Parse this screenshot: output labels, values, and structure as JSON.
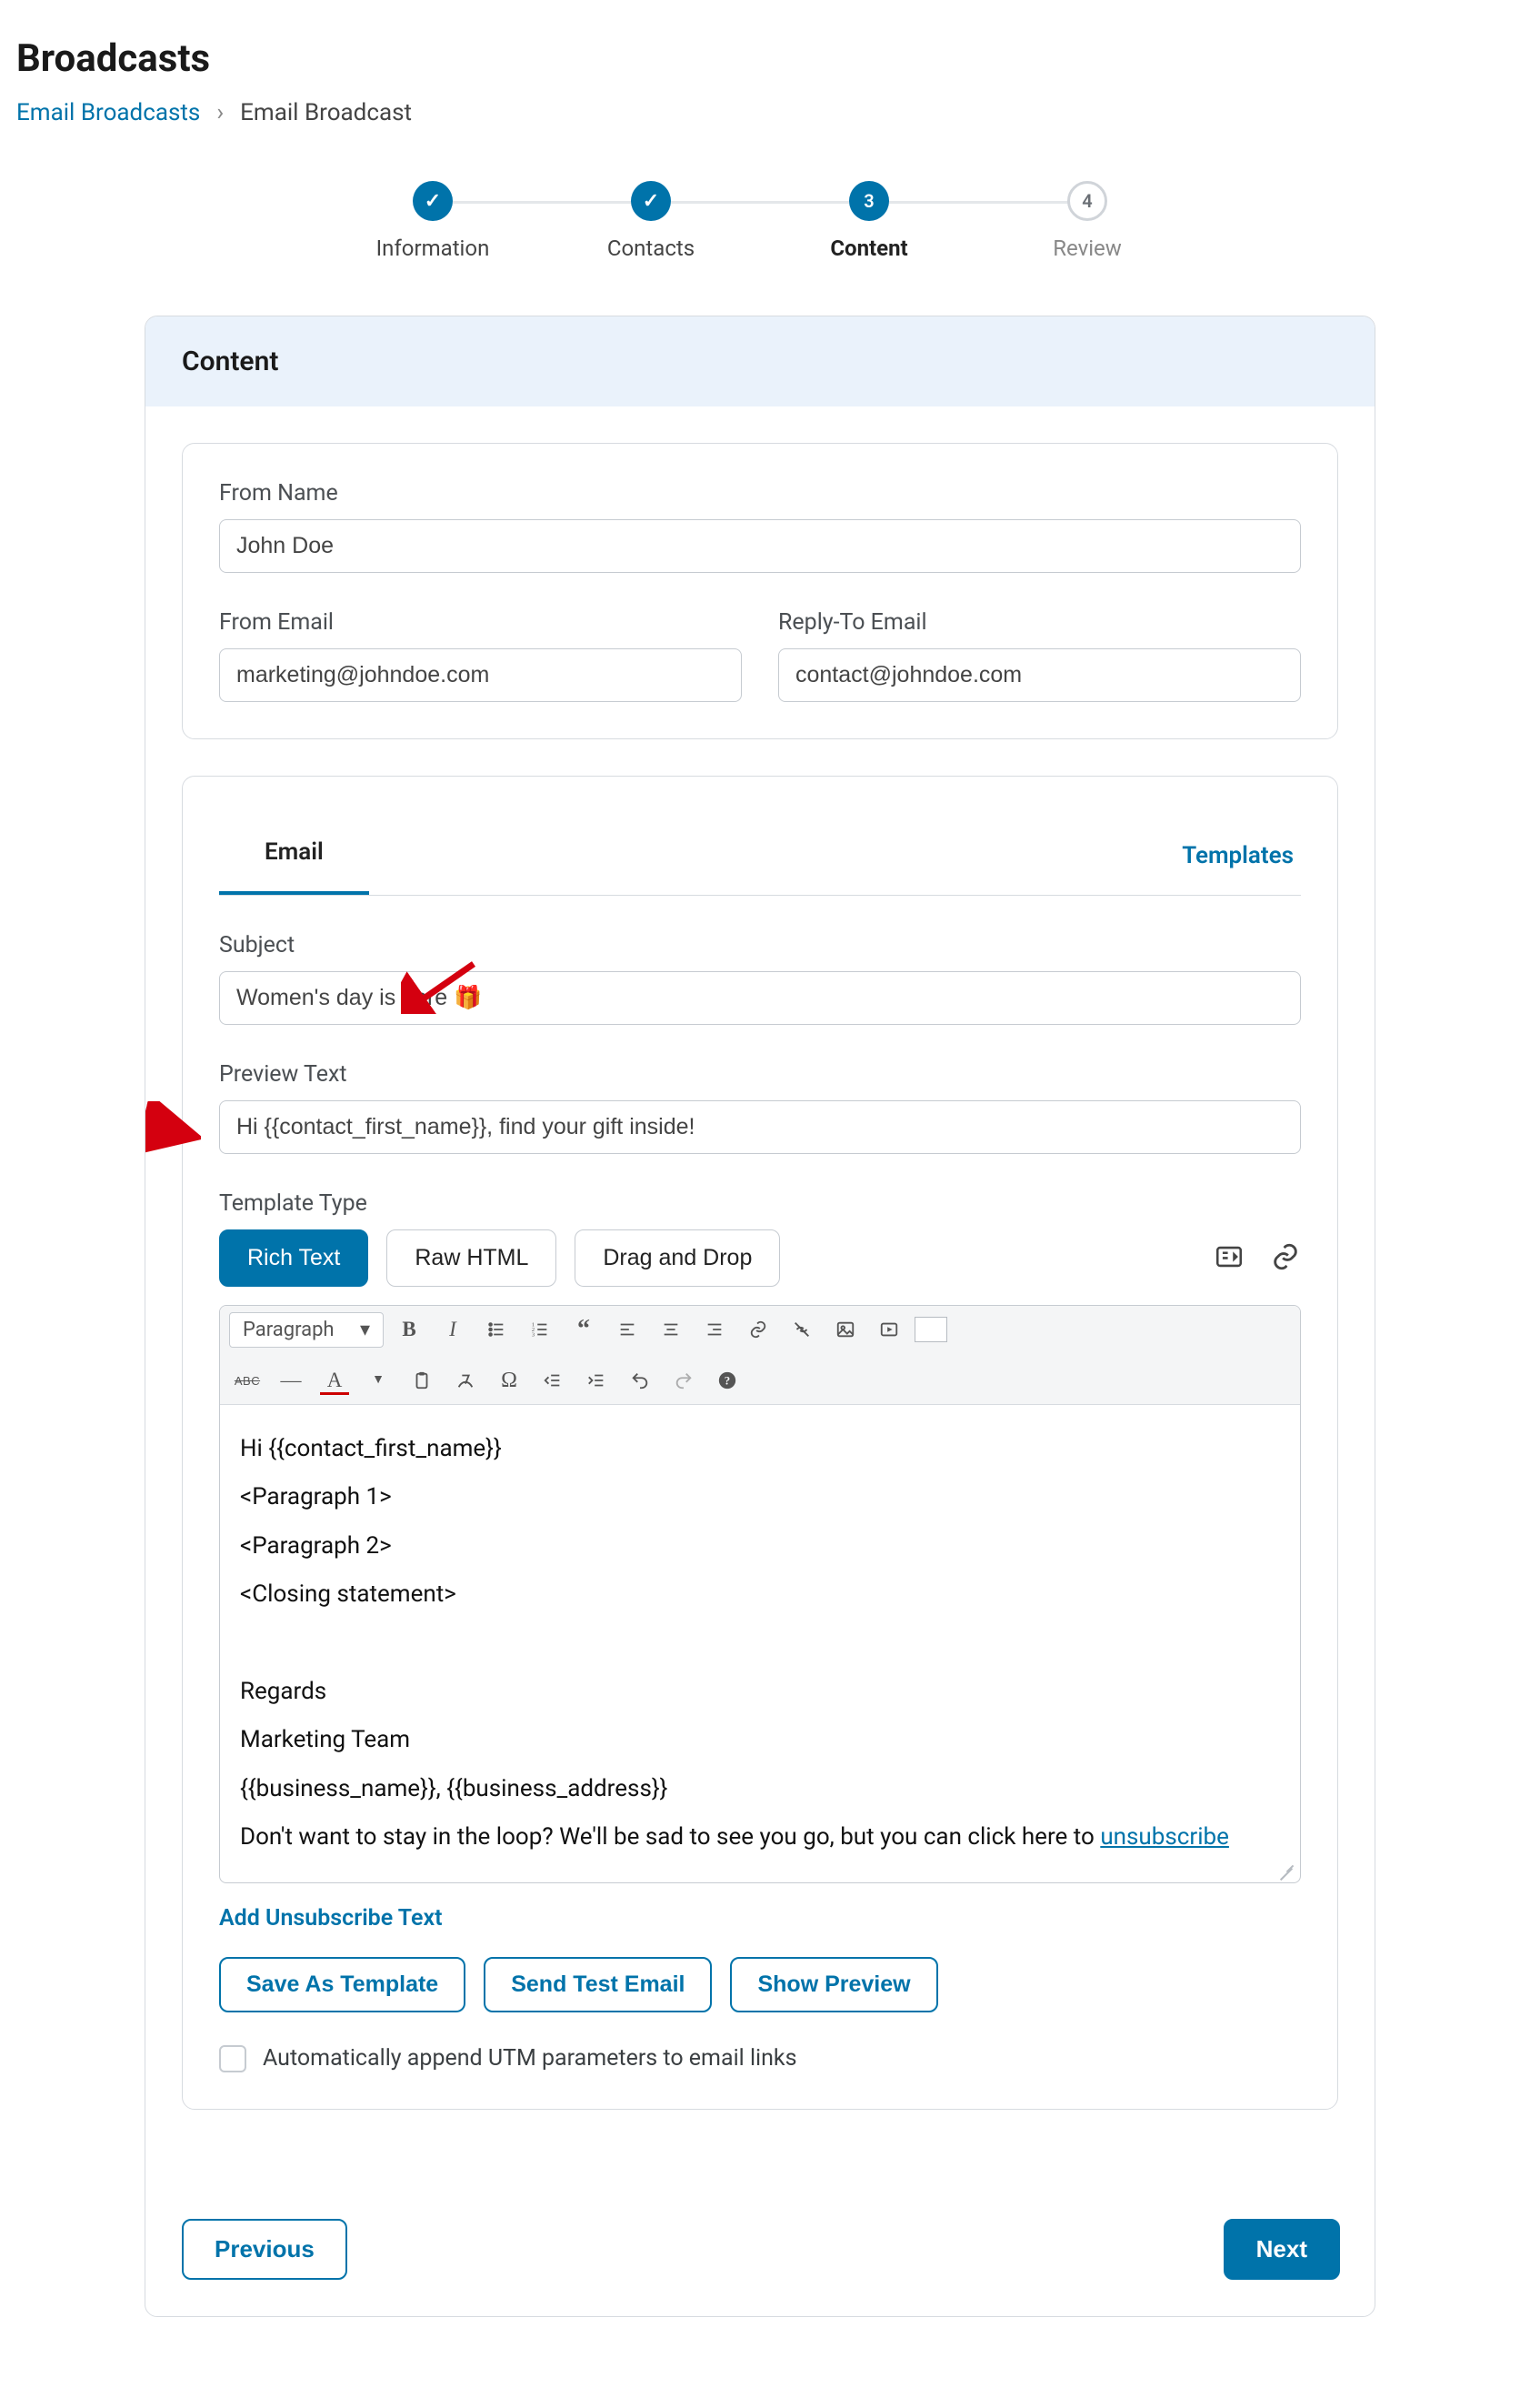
{
  "header": {
    "title": "Broadcasts"
  },
  "breadcrumb": {
    "root": "Email Broadcasts",
    "current": "Email Broadcast"
  },
  "stepper": {
    "steps": [
      {
        "label": "Information",
        "state": "done"
      },
      {
        "label": "Contacts",
        "state": "done"
      },
      {
        "label": "Content",
        "state": "current",
        "num": "3"
      },
      {
        "label": "Review",
        "state": "upcoming",
        "num": "4"
      }
    ]
  },
  "contentPanel": {
    "heading": "Content"
  },
  "from": {
    "nameLabel": "From Name",
    "nameValue": "John Doe",
    "emailLabel": "From Email",
    "emailValue": "marketing@johndoe.com",
    "replyLabel": "Reply-To Email",
    "replyValue": "contact@johndoe.com"
  },
  "emailTab": {
    "tabLabel": "Email",
    "templatesLink": "Templates",
    "subjectLabel": "Subject",
    "subjectValue": "Women's day is here 🎁",
    "previewLabel": "Preview Text",
    "previewValue": "Hi {{contact_first_name}}, find your gift inside!",
    "templateTypeLabel": "Template Type",
    "segments": {
      "rich": "Rich Text",
      "raw": "Raw HTML",
      "dnd": "Drag and Drop"
    }
  },
  "toolbar": {
    "paragraph": "Paragraph"
  },
  "editor": {
    "l1": "Hi {{contact_first_name}}",
    "l2": "<Paragraph 1>",
    "l3": "<Paragraph 2>",
    "l4": "<Closing statement>",
    "l5": "Regards",
    "l6": "Marketing Team",
    "l7": "{{business_name}}, {{business_address}}",
    "l8_pre": "Don't want to stay in the loop? We'll be sad to see you go, but you can click here to ",
    "l8_link": "unsubscribe"
  },
  "afterEditor": {
    "addUnsub": "Add Unsubscribe Text",
    "saveTemplate": "Save As Template",
    "sendTest": "Send Test Email",
    "showPreview": "Show Preview",
    "utm": "Automatically append UTM parameters to email links"
  },
  "nav": {
    "prev": "Previous",
    "next": "Next"
  }
}
